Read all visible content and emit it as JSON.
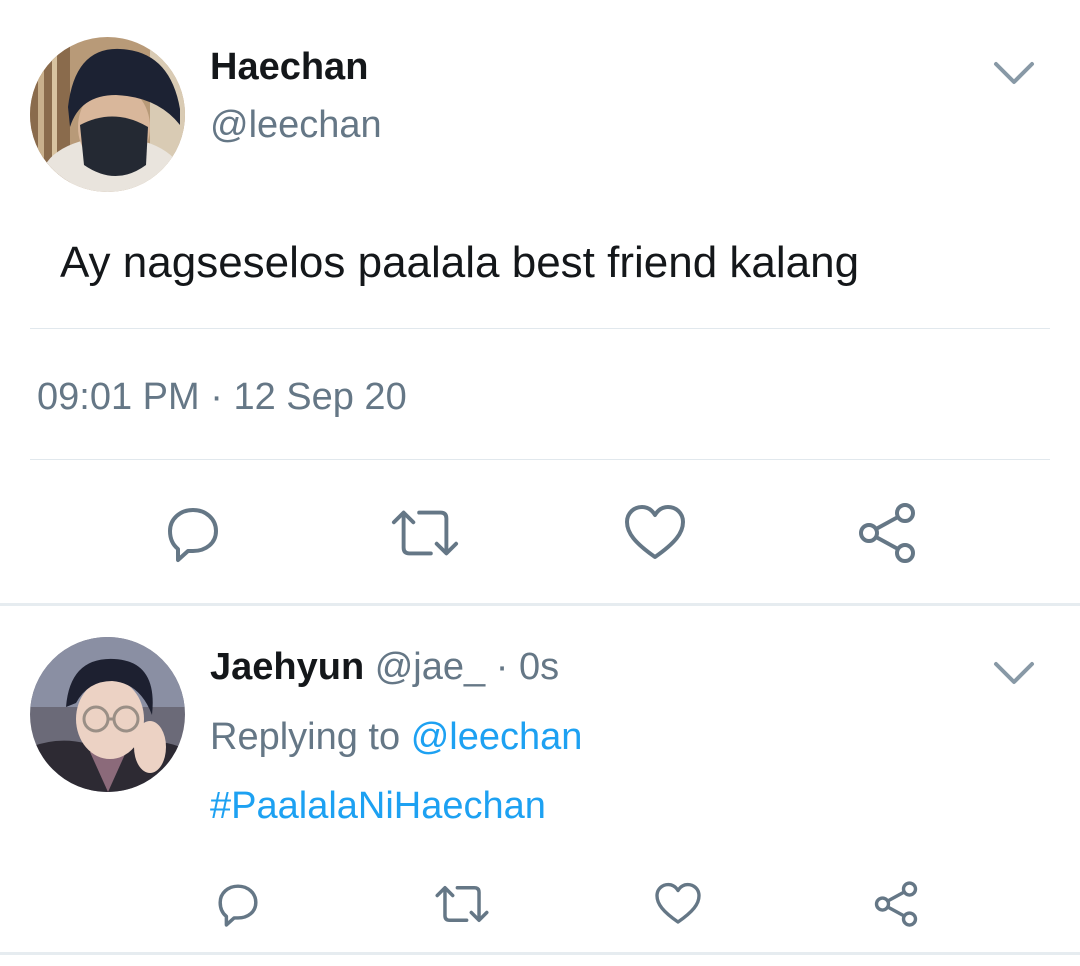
{
  "main_tweet": {
    "author": {
      "name": "Haechan",
      "handle": "@leechan"
    },
    "text": "Ay nagseselos paalala best friend kalang",
    "time": "09:01 PM",
    "separator": "·",
    "date": "12 Sep 20",
    "actions": [
      {
        "name": "reply",
        "icon": "reply-icon"
      },
      {
        "name": "retweet",
        "icon": "retweet-icon"
      },
      {
        "name": "like",
        "icon": "heart-icon"
      },
      {
        "name": "share",
        "icon": "share-icon"
      }
    ]
  },
  "reply_tweet": {
    "author": {
      "name": "Jaehyun",
      "handle": "@jae_"
    },
    "separator": "·",
    "age": "0s",
    "replying_label": "Replying to",
    "replying_to": "@leechan",
    "text": "#PaalalaNiHaechan"
  },
  "colors": {
    "text_primary": "#14171a",
    "text_secondary": "#657786",
    "link": "#1da1f2",
    "icon": "#657786",
    "divider": "#e1e8ed"
  }
}
